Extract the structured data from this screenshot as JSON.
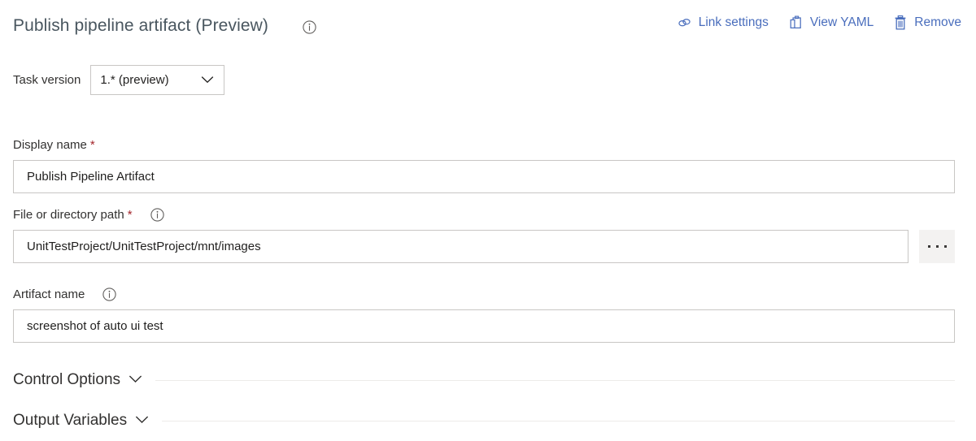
{
  "header": {
    "title": "Publish pipeline artifact (Preview)",
    "info_icon": "info-icon",
    "actions": [
      {
        "id": "link-settings",
        "label": "Link settings",
        "icon": "link-icon"
      },
      {
        "id": "view-yaml",
        "label": "View YAML",
        "icon": "clipboard-icon"
      },
      {
        "id": "remove",
        "label": "Remove",
        "icon": "trash-icon"
      }
    ],
    "action_color": "#4a6ebd",
    "title_color": "#49565f"
  },
  "task_version": {
    "label": "Task version",
    "value": "1.* (preview)",
    "chevron_icon": "chevron-down-icon"
  },
  "fields": [
    {
      "id": "display-name",
      "label": "Display name",
      "required": true,
      "required_marker": "*",
      "has_info": false,
      "value": "Publish Pipeline Artifact",
      "placeholder": "Display name"
    },
    {
      "id": "file-or-directory-path",
      "label": "File or directory path",
      "required": true,
      "required_marker": "*",
      "has_info": true,
      "info_icon": "info-icon",
      "value": "UnitTestProject/UnitTestProject/mnt/images",
      "placeholder": "File or directory path",
      "browse_button": {
        "label": "...",
        "icon": "ellipsis-icon"
      }
    },
    {
      "id": "artifact-name",
      "label": "Artifact name",
      "required": false,
      "required_marker": "",
      "has_info": true,
      "info_icon": "info-icon",
      "value": "screenshot of auto ui test",
      "placeholder": "Artifact name"
    }
  ],
  "sections": [
    {
      "id": "control-options",
      "title": "Control Options",
      "expanded": false,
      "chevron_icon": "chevron-down-icon"
    },
    {
      "id": "output-variables",
      "title": "Output Variables",
      "expanded": false,
      "chevron_icon": "chevron-down-icon"
    }
  ],
  "colors": {
    "required_asterisk": "#a4262c",
    "input_border": "#c8c6c4",
    "divider": "#edebe9",
    "browse_button_bg": "#f3f2f1",
    "text": "#323130"
  }
}
